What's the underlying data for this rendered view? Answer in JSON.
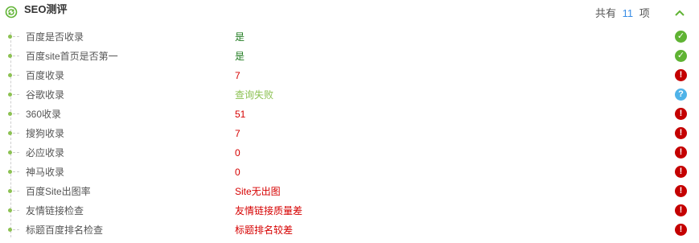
{
  "header": {
    "title": "SEO测评",
    "count_prefix": "共有",
    "count_value": "11",
    "count_suffix": "项",
    "icon": "refresh-circle-icon",
    "collapse_icon": "chevron-up-icon"
  },
  "colors": {
    "ok": "#5fb333",
    "error": "#c40000",
    "unknown": "#4fb3e8",
    "value_ok": "#1e7a1e",
    "value_error": "#d60000",
    "value_neutral": "#8cc152",
    "accent": "#3a8ee6"
  },
  "rows": [
    {
      "label": "百度是否收录",
      "value": "是",
      "tone": "ok",
      "status": "ok"
    },
    {
      "label": "百度site首页是否第一",
      "value": "是",
      "tone": "ok",
      "status": "ok"
    },
    {
      "label": "百度收录",
      "value": "7",
      "tone": "error",
      "status": "error"
    },
    {
      "label": "谷歌收录",
      "value": "查询失败",
      "tone": "neutral",
      "status": "unknown"
    },
    {
      "label": "360收录",
      "value": "51",
      "tone": "error",
      "status": "error"
    },
    {
      "label": "搜狗收录",
      "value": "7",
      "tone": "error",
      "status": "error"
    },
    {
      "label": "必应收录",
      "value": "0",
      "tone": "error",
      "status": "error"
    },
    {
      "label": "神马收录",
      "value": "0",
      "tone": "error",
      "status": "error"
    },
    {
      "label": "百度Site出图率",
      "value": "Site无出图",
      "tone": "error",
      "status": "error"
    },
    {
      "label": "友情链接检查",
      "value": "友情链接质量差",
      "tone": "error",
      "status": "error"
    },
    {
      "label": "标题百度排名检查",
      "value": "标题排名较差",
      "tone": "error",
      "status": "error"
    }
  ]
}
